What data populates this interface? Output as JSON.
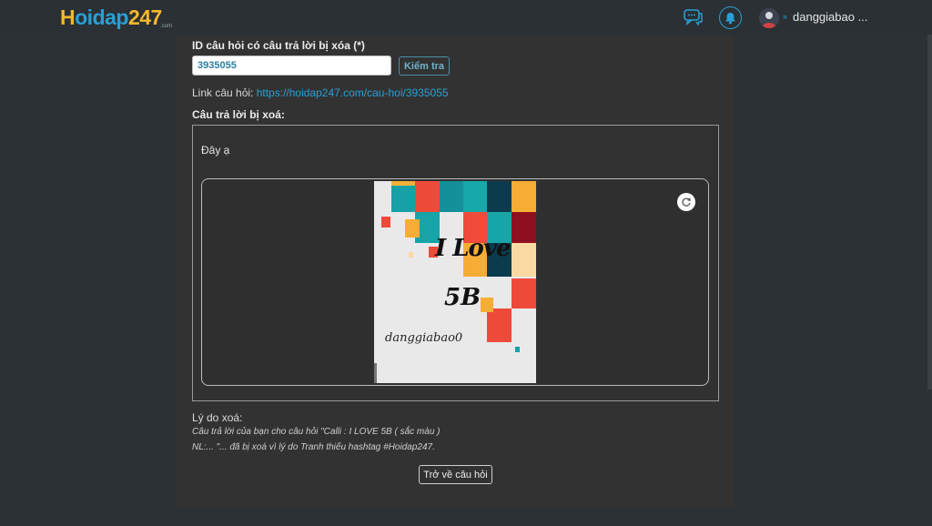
{
  "header": {
    "logo_h": "H",
    "logo_rest": "oidap",
    "logo_num": "247",
    "logo_sub": ".com",
    "chat_icon": "chat-bubbles-icon",
    "bell_icon": "bell-icon",
    "user_caret": "»",
    "username": "danggiabao ..."
  },
  "form": {
    "id_label": "ID câu hỏi có câu trả lời bị xóa (*)",
    "id_value": "3935055",
    "check_label": "Kiểm tra",
    "link_prefix": "Link câu hỏi: ",
    "link_url": "https://hoidap247.com/cau-hoi/3935055",
    "answer_label": "Câu trả lời bị xoá:"
  },
  "answer": {
    "text": "Đây ạ",
    "image": {
      "line1": "I Love",
      "line2": "5B",
      "signature": "danggiabao0"
    },
    "rotate_icon": "rotate-icon"
  },
  "reason": {
    "label": "Lý do xoá:",
    "line1": "Câu trả lời của bạn cho câu hỏi \"Calli : I LOVE 5B  ( sắc màu )",
    "line2": "NL:... \"... đã bị xoá vì lý do Tranh thiếu hashtag #Hoidap247."
  },
  "back_button": "Trở về câu hỏi",
  "colors": {
    "accent": "#2a9fd6",
    "logo_yellow": "#f5b82e",
    "background": "#2b3135",
    "panel": "#323232"
  }
}
